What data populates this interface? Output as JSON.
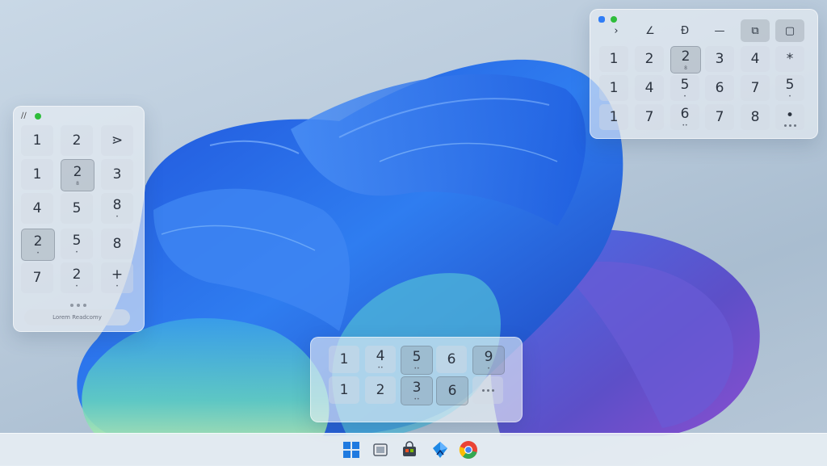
{
  "colors": {
    "accent": "#3b6fe0",
    "green_dot": "#2ebd3b",
    "blue_dot": "#2f7df6"
  },
  "left_panel": {
    "header_icon": "leaf-icon",
    "rows": [
      [
        {
          "label": "1"
        },
        {
          "label": "2"
        },
        {
          "label": "⋗"
        }
      ],
      [
        {
          "label": "1"
        },
        {
          "label": "2",
          "sub": "8",
          "state": "selected"
        },
        {
          "label": "3"
        }
      ],
      [
        {
          "label": "4"
        },
        {
          "label": "5"
        },
        {
          "label": "8",
          "sub": "•"
        }
      ],
      [
        {
          "label": "2",
          "sub": "•",
          "state": "selected"
        },
        {
          "label": "5",
          "sub": "•"
        },
        {
          "label": "8"
        }
      ],
      [
        {
          "label": "7"
        },
        {
          "label": "2",
          "sub": "•"
        },
        {
          "label": "+",
          "sub": "•"
        }
      ]
    ],
    "footer_label": "Lorem Readcomy"
  },
  "right_panel": {
    "header_icon": "chat-icon",
    "toolbar": [
      {
        "label": "›",
        "icon": "chevron-right-icon"
      },
      {
        "label": "∠",
        "icon": "angle-icon"
      },
      {
        "label": "Ð",
        "icon": "eth-icon"
      },
      {
        "label": "—",
        "icon": "minimize-icon"
      },
      {
        "label": "⧉",
        "icon": "edit-icon"
      },
      {
        "label": "▢",
        "icon": "restore-icon"
      }
    ],
    "rows": [
      [
        {
          "label": "1"
        },
        {
          "label": "2"
        },
        {
          "label": "2",
          "sub": "8",
          "state": "selected"
        },
        {
          "label": "3"
        },
        {
          "label": "4"
        },
        {
          "label": "*"
        }
      ],
      [
        {
          "label": "1"
        },
        {
          "label": "4"
        },
        {
          "label": "5",
          "sub": "•"
        },
        {
          "label": "6"
        },
        {
          "label": "7"
        },
        {
          "label": "5",
          "sub": "•"
        }
      ],
      [
        {
          "label": "1"
        },
        {
          "label": "7"
        },
        {
          "label": "6",
          "sub": "••"
        },
        {
          "label": "7"
        },
        {
          "label": "8"
        },
        {
          "label": "•",
          "sub": "dots"
        }
      ]
    ]
  },
  "bottom_panel": {
    "rows": [
      [
        {
          "label": "1"
        },
        {
          "label": "4",
          "sub": "••"
        },
        {
          "label": "5",
          "sub": "••",
          "state": "selected"
        },
        {
          "label": "6"
        },
        {
          "label": "9",
          "sub": "•",
          "state": "selected"
        }
      ],
      [
        {
          "label": "1"
        },
        {
          "label": "2"
        },
        {
          "label": "3",
          "sub": "••",
          "state": "selected"
        },
        {
          "label": "6",
          "state": "selected"
        },
        {
          "label": "",
          "sub": "dots"
        }
      ]
    ]
  },
  "taskbar": {
    "items": [
      {
        "icon": "windows-start-icon"
      },
      {
        "icon": "file-explorer-icon"
      },
      {
        "icon": "store-bag-icon"
      },
      {
        "icon": "edge-shield-icon"
      },
      {
        "icon": "chrome-icon"
      }
    ]
  }
}
